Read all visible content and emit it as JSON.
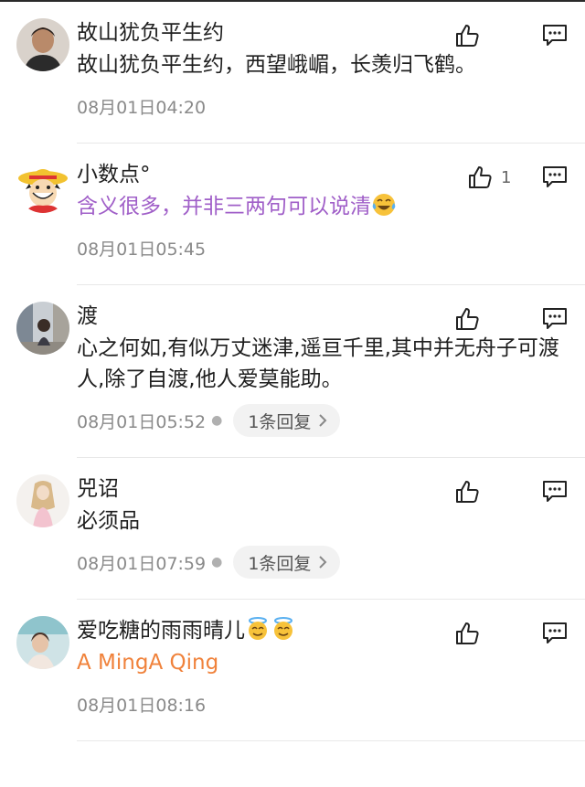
{
  "comments": [
    {
      "author": "故山犹负平生约",
      "text": "故山犹负平生约，西望峨嵋，长羡归飞鹤。",
      "time": "08月01日04:20",
      "likes": "",
      "avatar_icon": "man-portrait-avatar"
    },
    {
      "author": "小数点°",
      "text": "含义很多，并非三两句可以说清",
      "text_color": "#a05fc8",
      "time": "08月01日05:45",
      "likes": "1",
      "avatar_icon": "cartoon-straw-hat-avatar"
    },
    {
      "author": "渡",
      "text": "心之何如,有似万丈迷津,遥亘千里,其中并无舟子可渡人,除了自渡,他人爱莫能助。",
      "time": "08月01日05:52",
      "likes": "",
      "reply": "1条回复",
      "avatar_icon": "street-photo-avatar"
    },
    {
      "author": "兕诏",
      "text": "必须品",
      "time": "08月01日07:59",
      "likes": "",
      "reply": "1条回复",
      "avatar_icon": "girl-sketch-avatar"
    },
    {
      "author": "爱吃糖的雨雨晴儿",
      "text": "A MingA Qing",
      "text_color": "#f0823b",
      "time": "08月01日08:16",
      "likes": "",
      "avatar_icon": "girl-photo-avatar"
    }
  ]
}
